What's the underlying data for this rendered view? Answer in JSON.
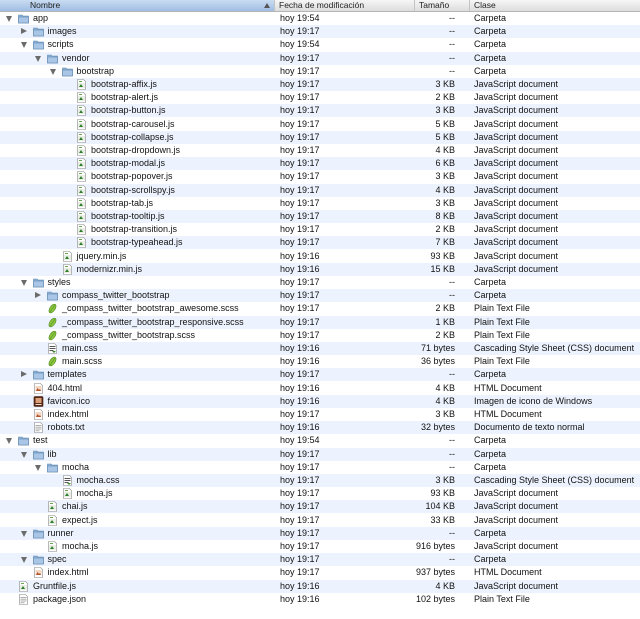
{
  "columns": {
    "name": "Nombre",
    "date": "Fecha de modificación",
    "size": "Tamaño",
    "kind": "Clase"
  },
  "rows": [
    {
      "name": "app",
      "level": 0,
      "type": "folder",
      "expanded": true,
      "date": "hoy 19:54",
      "size": "--",
      "kind": "Carpeta"
    },
    {
      "name": "images",
      "level": 1,
      "type": "folder",
      "expanded": false,
      "date": "hoy 19:17",
      "size": "--",
      "kind": "Carpeta"
    },
    {
      "name": "scripts",
      "level": 1,
      "type": "folder",
      "expanded": true,
      "date": "hoy 19:54",
      "size": "--",
      "kind": "Carpeta"
    },
    {
      "name": "vendor",
      "level": 2,
      "type": "folder",
      "expanded": true,
      "date": "hoy 19:17",
      "size": "--",
      "kind": "Carpeta"
    },
    {
      "name": "bootstrap",
      "level": 3,
      "type": "folder",
      "expanded": true,
      "date": "hoy 19:17",
      "size": "--",
      "kind": "Carpeta"
    },
    {
      "name": "bootstrap-affix.js",
      "level": 4,
      "type": "js",
      "date": "hoy 19:17",
      "size": "3 KB",
      "kind": "JavaScript document"
    },
    {
      "name": "bootstrap-alert.js",
      "level": 4,
      "type": "js",
      "date": "hoy 19:17",
      "size": "2 KB",
      "kind": "JavaScript document"
    },
    {
      "name": "bootstrap-button.js",
      "level": 4,
      "type": "js",
      "date": "hoy 19:17",
      "size": "3 KB",
      "kind": "JavaScript document"
    },
    {
      "name": "bootstrap-carousel.js",
      "level": 4,
      "type": "js",
      "date": "hoy 19:17",
      "size": "5 KB",
      "kind": "JavaScript document"
    },
    {
      "name": "bootstrap-collapse.js",
      "level": 4,
      "type": "js",
      "date": "hoy 19:17",
      "size": "5 KB",
      "kind": "JavaScript document"
    },
    {
      "name": "bootstrap-dropdown.js",
      "level": 4,
      "type": "js",
      "date": "hoy 19:17",
      "size": "4 KB",
      "kind": "JavaScript document"
    },
    {
      "name": "bootstrap-modal.js",
      "level": 4,
      "type": "js",
      "date": "hoy 19:17",
      "size": "6 KB",
      "kind": "JavaScript document"
    },
    {
      "name": "bootstrap-popover.js",
      "level": 4,
      "type": "js",
      "date": "hoy 19:17",
      "size": "3 KB",
      "kind": "JavaScript document"
    },
    {
      "name": "bootstrap-scrollspy.js",
      "level": 4,
      "type": "js",
      "date": "hoy 19:17",
      "size": "4 KB",
      "kind": "JavaScript document"
    },
    {
      "name": "bootstrap-tab.js",
      "level": 4,
      "type": "js",
      "date": "hoy 19:17",
      "size": "3 KB",
      "kind": "JavaScript document"
    },
    {
      "name": "bootstrap-tooltip.js",
      "level": 4,
      "type": "js",
      "date": "hoy 19:17",
      "size": "8 KB",
      "kind": "JavaScript document"
    },
    {
      "name": "bootstrap-transition.js",
      "level": 4,
      "type": "js",
      "date": "hoy 19:17",
      "size": "2 KB",
      "kind": "JavaScript document"
    },
    {
      "name": "bootstrap-typeahead.js",
      "level": 4,
      "type": "js",
      "date": "hoy 19:17",
      "size": "7 KB",
      "kind": "JavaScript document"
    },
    {
      "name": "jquery.min.js",
      "level": 3,
      "type": "js",
      "date": "hoy 19:16",
      "size": "93 KB",
      "kind": "JavaScript document"
    },
    {
      "name": "modernizr.min.js",
      "level": 3,
      "type": "js",
      "date": "hoy 19:16",
      "size": "15 KB",
      "kind": "JavaScript document"
    },
    {
      "name": "styles",
      "level": 1,
      "type": "folder",
      "expanded": true,
      "date": "hoy 19:17",
      "size": "--",
      "kind": "Carpeta"
    },
    {
      "name": "compass_twitter_bootstrap",
      "level": 2,
      "type": "folder",
      "expanded": false,
      "date": "hoy 19:17",
      "size": "--",
      "kind": "Carpeta"
    },
    {
      "name": "_compass_twitter_bootstrap_awesome.scss",
      "level": 2,
      "type": "text",
      "date": "hoy 19:17",
      "size": "2 KB",
      "kind": "Plain Text File"
    },
    {
      "name": "_compass_twitter_bootstrap_responsive.scss",
      "level": 2,
      "type": "text",
      "date": "hoy 19:17",
      "size": "1 KB",
      "kind": "Plain Text File"
    },
    {
      "name": "_compass_twitter_bootstrap.scss",
      "level": 2,
      "type": "text",
      "date": "hoy 19:17",
      "size": "2 KB",
      "kind": "Plain Text File"
    },
    {
      "name": "main.css",
      "level": 2,
      "type": "css",
      "date": "hoy 19:16",
      "size": "71 bytes",
      "kind": "Cascading Style Sheet (CSS) document"
    },
    {
      "name": "main.scss",
      "level": 2,
      "type": "text",
      "date": "hoy 19:16",
      "size": "36 bytes",
      "kind": "Plain Text File"
    },
    {
      "name": "templates",
      "level": 1,
      "type": "folder",
      "expanded": false,
      "date": "hoy 19:17",
      "size": "--",
      "kind": "Carpeta"
    },
    {
      "name": "404.html",
      "level": 1,
      "type": "html",
      "date": "hoy 19:16",
      "size": "4 KB",
      "kind": "HTML Document"
    },
    {
      "name": "favicon.ico",
      "level": 1,
      "type": "ico",
      "date": "hoy 19:16",
      "size": "4 KB",
      "kind": "Imagen de icono de Windows"
    },
    {
      "name": "index.html",
      "level": 1,
      "type": "html",
      "date": "hoy 19:17",
      "size": "3 KB",
      "kind": "HTML Document"
    },
    {
      "name": "robots.txt",
      "level": 1,
      "type": "txt",
      "date": "hoy 19:16",
      "size": "32 bytes",
      "kind": "Documento de texto normal"
    },
    {
      "name": "test",
      "level": 0,
      "type": "folder",
      "expanded": true,
      "date": "hoy 19:54",
      "size": "--",
      "kind": "Carpeta"
    },
    {
      "name": "lib",
      "level": 1,
      "type": "folder",
      "expanded": true,
      "date": "hoy 19:17",
      "size": "--",
      "kind": "Carpeta"
    },
    {
      "name": "mocha",
      "level": 2,
      "type": "folder",
      "expanded": true,
      "date": "hoy 19:17",
      "size": "--",
      "kind": "Carpeta"
    },
    {
      "name": "mocha.css",
      "level": 3,
      "type": "css",
      "date": "hoy 19:17",
      "size": "3 KB",
      "kind": "Cascading Style Sheet (CSS) document"
    },
    {
      "name": "mocha.js",
      "level": 3,
      "type": "js",
      "date": "hoy 19:17",
      "size": "93 KB",
      "kind": "JavaScript document"
    },
    {
      "name": "chai.js",
      "level": 2,
      "type": "js",
      "date": "hoy 19:17",
      "size": "104 KB",
      "kind": "JavaScript document"
    },
    {
      "name": "expect.js",
      "level": 2,
      "type": "js",
      "date": "hoy 19:17",
      "size": "33 KB",
      "kind": "JavaScript document"
    },
    {
      "name": "runner",
      "level": 1,
      "type": "folder",
      "expanded": true,
      "date": "hoy 19:17",
      "size": "--",
      "kind": "Carpeta"
    },
    {
      "name": "mocha.js",
      "level": 2,
      "type": "js",
      "date": "hoy 19:17",
      "size": "916 bytes",
      "kind": "JavaScript document"
    },
    {
      "name": "spec",
      "level": 1,
      "type": "folder",
      "expanded": true,
      "date": "hoy 19:17",
      "size": "--",
      "kind": "Carpeta"
    },
    {
      "name": "index.html",
      "level": 1,
      "type": "html",
      "date": "hoy 19:17",
      "size": "937 bytes",
      "kind": "HTML Document"
    },
    {
      "name": "Gruntfile.js",
      "level": 0,
      "type": "js",
      "date": "hoy 19:16",
      "size": "4 KB",
      "kind": "JavaScript document"
    },
    {
      "name": "package.json",
      "level": 0,
      "type": "txt",
      "date": "hoy 19:16",
      "size": "102 bytes",
      "kind": "Plain Text File"
    }
  ]
}
